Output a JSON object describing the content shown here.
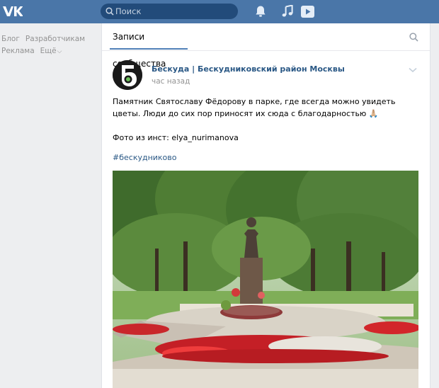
{
  "header": {
    "search_placeholder": "Поиск",
    "brand_color": "#4a76a8"
  },
  "left_menu": {
    "items": [
      "Блог",
      "Разработчикам",
      "Реклама",
      "Ещё"
    ]
  },
  "tabs": {
    "active_label": "Записи сообщества"
  },
  "post": {
    "author": "Бескуда | Бескудниковский район Москвы",
    "time": "час назад",
    "text_line1": "Памятник Святославу Фёдорову в парке, где всегда можно увидеть цветы. Люди до сих пор приносят их сюда с благодарностью 🙏🏼",
    "text_line2": "Фото из инст: elya_nurimanova",
    "hashtag": "#бескудниково",
    "avatar_letter": "Б"
  },
  "icons": {
    "logo": "vk-logo-icon",
    "search": "search-icon",
    "bell": "bell-icon",
    "music": "music-icon",
    "video": "play-icon",
    "more": "chevron-down-icon"
  }
}
